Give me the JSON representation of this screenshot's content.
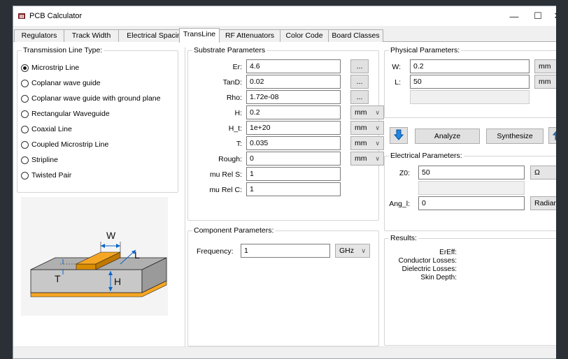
{
  "window": {
    "title": "PCB Calculator",
    "minimize": "—",
    "maximize": "☐",
    "close": "✕"
  },
  "tabs": [
    {
      "label": "Regulators"
    },
    {
      "label": "Track Width"
    },
    {
      "label": "Electrical Spacing"
    },
    {
      "label": "TransLine"
    },
    {
      "label": "RF Attenuators"
    },
    {
      "label": "Color Code"
    },
    {
      "label": "Board Classes"
    }
  ],
  "active_tab": "TransLine",
  "tline_type": {
    "title": "Transmission Line Type:",
    "options": [
      {
        "label": "Microstrip Line",
        "selected": true
      },
      {
        "label": "Coplanar wave guide",
        "selected": false
      },
      {
        "label": "Coplanar wave guide with ground plane",
        "selected": false
      },
      {
        "label": "Rectangular Waveguide",
        "selected": false
      },
      {
        "label": "Coaxial Line",
        "selected": false
      },
      {
        "label": "Coupled Microstrip Line",
        "selected": false
      },
      {
        "label": "Stripline",
        "selected": false
      },
      {
        "label": "Twisted Pair",
        "selected": false
      }
    ]
  },
  "diagram": {
    "w": "W",
    "l": "L",
    "t": "T",
    "h": "H"
  },
  "substrate": {
    "title": "Substrate Parameters",
    "rows": [
      {
        "label": "Er:",
        "value": "4.6",
        "extra": "..."
      },
      {
        "label": "TanD:",
        "value": "0.02",
        "extra": "..."
      },
      {
        "label": "Rho:",
        "value": "1.72e-08",
        "extra": "..."
      },
      {
        "label": "H:",
        "value": "0.2",
        "unit": "mm"
      },
      {
        "label": "H_t:",
        "value": "1e+20",
        "unit": "mm"
      },
      {
        "label": "T:",
        "value": "0.035",
        "unit": "mm"
      },
      {
        "label": "Rough:",
        "value": "0",
        "unit": "mm"
      },
      {
        "label": "mu Rel S:",
        "value": "1"
      },
      {
        "label": "mu Rel C:",
        "value": "1"
      }
    ]
  },
  "component": {
    "title": "Component Parameters:",
    "freq_label": "Frequency:",
    "freq_value": "1",
    "freq_unit": "GHz"
  },
  "physical": {
    "title": "Physical Parameters:",
    "w_label": "W:",
    "w_value": "0.2",
    "w_unit": "mm",
    "l_label": "L:",
    "l_value": "50",
    "l_unit": "mm"
  },
  "actions": {
    "analyze": "Analyze",
    "synthesize": "Synthesize"
  },
  "electrical": {
    "title": "Electrical Parameters:",
    "z0_label": "Z0:",
    "z0_value": "50",
    "z0_unit": "Ω",
    "ang_label": "Ang_l:",
    "ang_value": "0",
    "ang_unit": "Radian"
  },
  "results": {
    "title": "Results:",
    "labels": [
      "ErEff:",
      "Conductor Losses:",
      "Dielectric Losses:",
      "Skin Depth:"
    ]
  },
  "colors": {
    "accent": "#0a64c8",
    "copper": "#f5a623"
  }
}
